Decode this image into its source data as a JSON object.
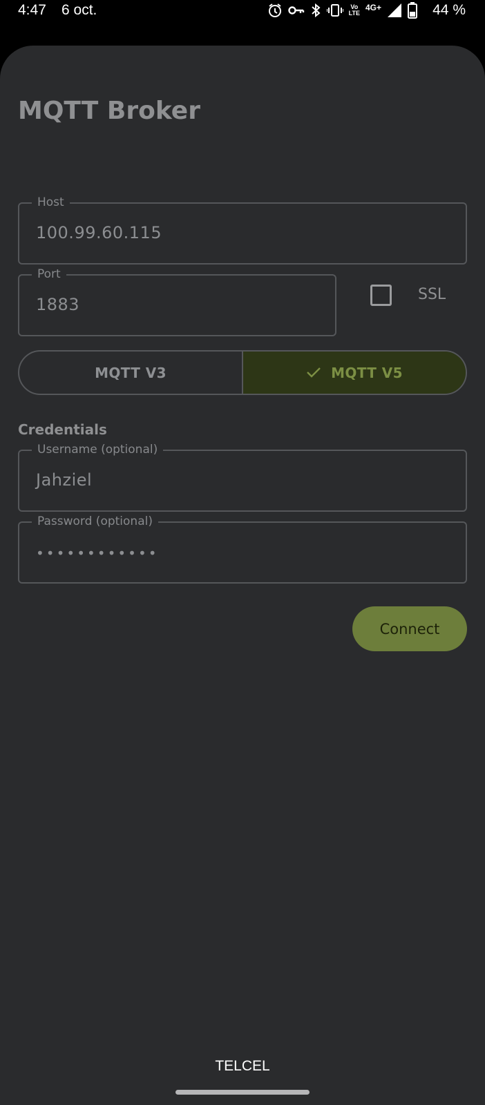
{
  "status_bar": {
    "time": "4:47",
    "date": "6 oct.",
    "network_top": "Vo",
    "network_bottom": "LTE",
    "network_type": "4G+",
    "battery": "44 %",
    "icons": [
      "alarm-icon",
      "vpn-key-icon",
      "bluetooth-icon",
      "vibrate-icon",
      "volte-icon",
      "signal-icon",
      "battery-icon"
    ]
  },
  "page": {
    "title": "MQTT Broker"
  },
  "host_field": {
    "label": "Host",
    "value": "100.99.60.115"
  },
  "port_field": {
    "label": "Port",
    "value": "1883"
  },
  "ssl": {
    "label": "SSL",
    "checked": false
  },
  "protocol_toggle": {
    "options": [
      "MQTT V3",
      "MQTT V5"
    ],
    "selected": "MQTT V5"
  },
  "credentials": {
    "section_title": "Credentials",
    "username_label": "Username (optional)",
    "username_value": "Jahziel",
    "password_label": "Password (optional)",
    "password_value": "••••••••••••"
  },
  "actions": {
    "connect_label": "Connect"
  },
  "footer": {
    "carrier": "TELCEL"
  },
  "colors": {
    "background": "#2a2b2d",
    "selected_segment": "#2d3616",
    "accent_button": "#6d7e3b"
  }
}
